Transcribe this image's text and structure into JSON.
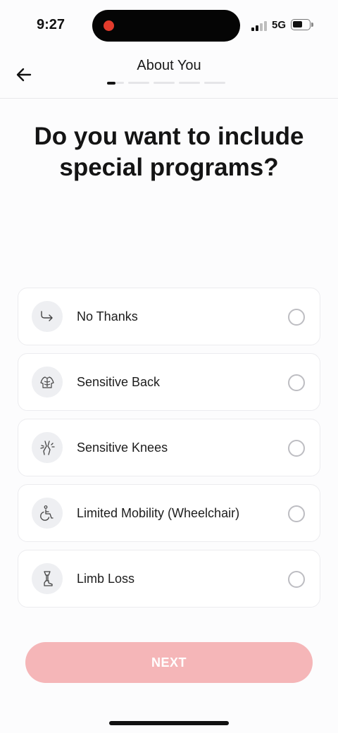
{
  "status_bar": {
    "time": "9:27",
    "network": "5G",
    "battery_level": 0.6
  },
  "header": {
    "title": "About You",
    "progress": {
      "current_step": 1,
      "total_steps": 5
    }
  },
  "question": "Do you want to include special programs?",
  "options": [
    {
      "label": "No Thanks",
      "icon": "skip-arrow-icon",
      "selected": false
    },
    {
      "label": "Sensitive Back",
      "icon": "sensitive-back-icon",
      "selected": false
    },
    {
      "label": "Sensitive Knees",
      "icon": "sensitive-knees-icon",
      "selected": false
    },
    {
      "label": "Limited Mobility (Wheelchair)",
      "icon": "wheelchair-icon",
      "selected": false
    },
    {
      "label": "Limb Loss",
      "icon": "prosthetic-leg-icon",
      "selected": false
    }
  ],
  "next_button": {
    "label": "NEXT",
    "enabled": false,
    "color": "#f5b6b8"
  },
  "colors": {
    "accent_disabled": "#f5b6b8",
    "recording_dot": "#e23b2c"
  }
}
